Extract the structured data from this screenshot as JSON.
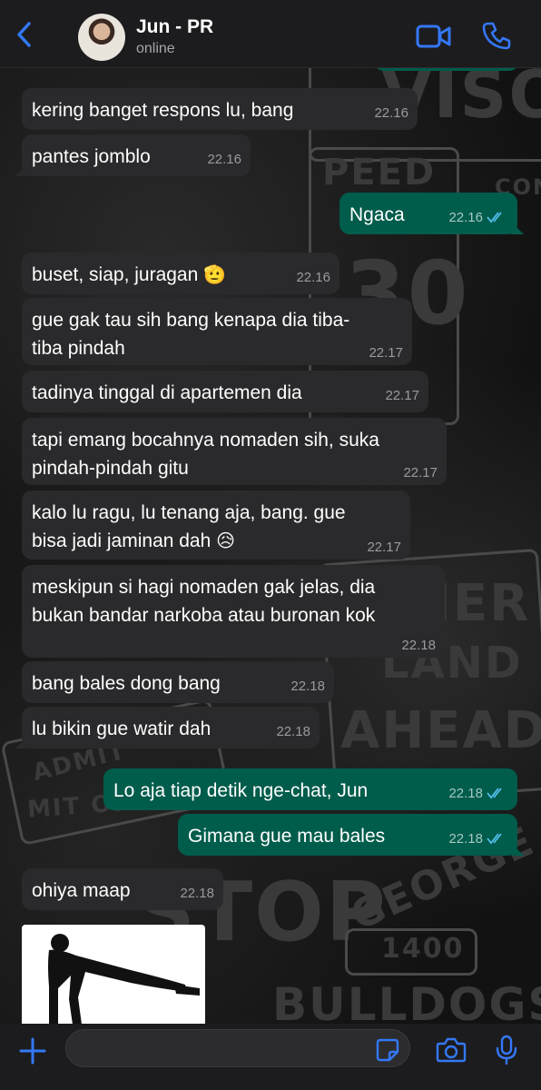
{
  "header": {
    "contact_name": "Jun - PR",
    "status": "online"
  },
  "messages": [
    {
      "dir": "in",
      "text": "kering banget respons lu, bang",
      "time": "22.16"
    },
    {
      "dir": "in",
      "text": "pantes jomblo",
      "time": "22.16"
    },
    {
      "dir": "out",
      "text": "Ngaca",
      "time": "22.16",
      "ticks": "read"
    },
    {
      "dir": "in",
      "text": "buset, siap, juragan",
      "emoji": "🫡",
      "time": "22.16"
    },
    {
      "dir": "in",
      "text": "gue gak tau sih bang kenapa dia tiba-\ntiba pindah",
      "time": "22.17"
    },
    {
      "dir": "in",
      "text": "tadinya tinggal di apartemen dia",
      "time": "22.17"
    },
    {
      "dir": "in",
      "text": "tapi emang bocahnya nomaden sih, suka\npindah-pindah gitu",
      "time": "22.17"
    },
    {
      "dir": "in",
      "text": "kalo lu ragu, lu tenang aja, bang. gue\nbisa jadi jaminan dah",
      "emoji": "😥",
      "time": "22.17"
    },
    {
      "dir": "in",
      "text": "meskipun si hagi nomaden gak jelas, dia\nbukan bandar narkoba atau buronan kok",
      "time": "22.18"
    },
    {
      "dir": "in",
      "text": "bang bales dong bang",
      "time": "22.18"
    },
    {
      "dir": "in",
      "text": "lu bikin gue watir dah",
      "time": "22.18"
    },
    {
      "dir": "out",
      "text": "Lo aja tiap detik nge-chat, Jun",
      "time": "22.18",
      "ticks": "read"
    },
    {
      "dir": "out",
      "text": "Gimana gue mau bales",
      "time": "22.18",
      "ticks": "read"
    },
    {
      "dir": "in",
      "text": "ohiya maap",
      "time": "22.18"
    }
  ],
  "wallpaper_words": {
    "w1": "VISO",
    "w2": "PEED",
    "w3": "30",
    "w4": "AHEAD",
    "w5": "LAND",
    "w6": "NER",
    "w7": "ADMIT",
    "w8": "MIT ONE",
    "w9": "STOP",
    "w10": "GEORGE",
    "w11": "1400",
    "w12": "BULLDOGS",
    "w13": "CONT"
  },
  "input": {
    "placeholder": "",
    "value": ""
  },
  "colors": {
    "incoming": "#2a2a2c",
    "outgoing": "#005c4b",
    "accent": "#3478f6",
    "read_ticks": "#53bdeb"
  },
  "icons": {
    "back": "chevron-left-icon",
    "video": "video-camera-icon",
    "call": "phone-icon",
    "plus": "plus-icon",
    "sticker": "sticker-icon",
    "camera": "camera-icon",
    "mic": "microphone-icon"
  }
}
